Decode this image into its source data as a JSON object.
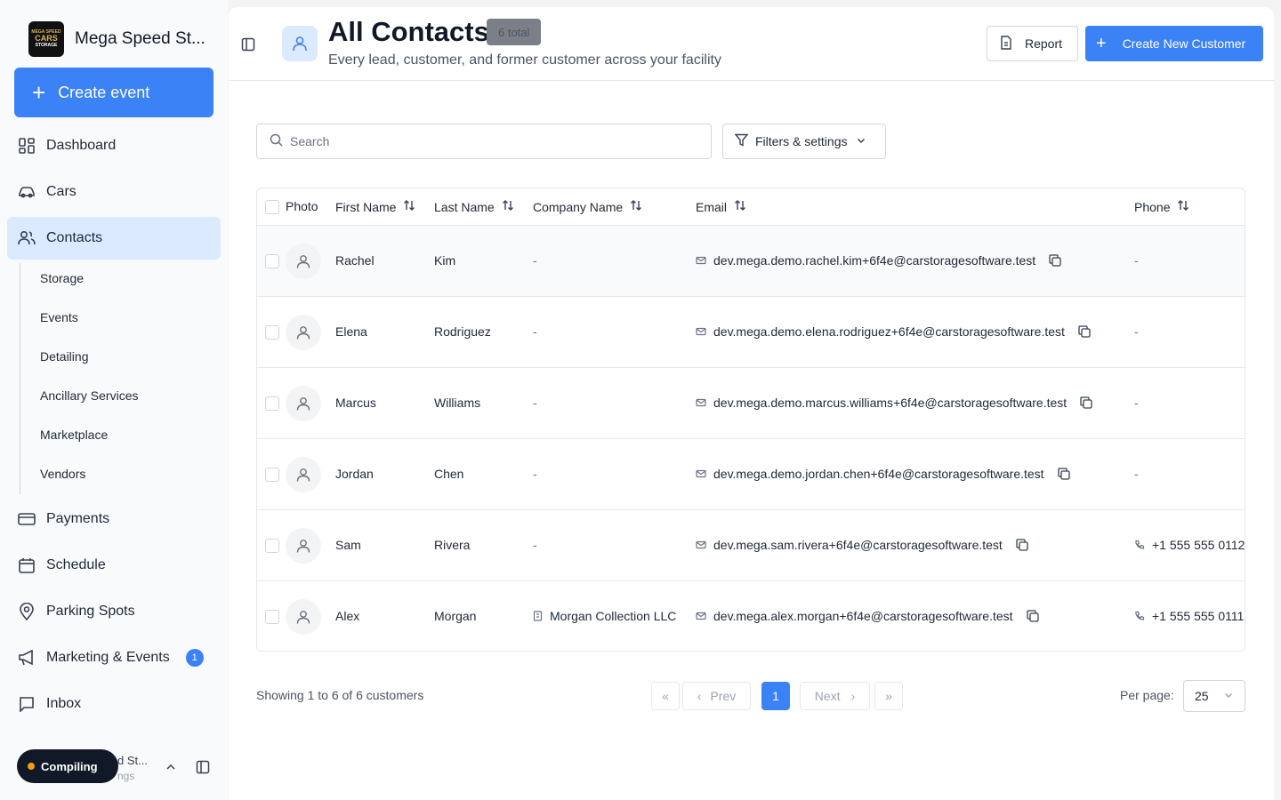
{
  "brand": {
    "name": "Mega Speed St...",
    "logo_text": [
      "MEGA SPEED",
      "CARS",
      "STORAGE"
    ]
  },
  "sidebar": {
    "create_label": "Create event",
    "nav": [
      {
        "label": "Dashboard",
        "icon": "dashboard-icon"
      },
      {
        "label": "Cars",
        "icon": "car-icon"
      },
      {
        "label": "Contacts",
        "icon": "users-icon",
        "active": true
      },
      {
        "label": "Payments",
        "icon": "credit-card-icon"
      },
      {
        "label": "Schedule",
        "icon": "calendar-icon"
      },
      {
        "label": "Parking Spots",
        "icon": "map-pin-icon"
      },
      {
        "label": "Marketing & Events",
        "icon": "megaphone-icon",
        "badge": "1"
      },
      {
        "label": "Inbox",
        "icon": "inbox-icon"
      }
    ],
    "subnav": [
      "Storage",
      "Events",
      "Detailing",
      "Ancillary Services",
      "Marketplace",
      "Vendors"
    ],
    "status_label": "Compiling",
    "user_name_peek": "d St...",
    "user_sub_peek": "ngs"
  },
  "header": {
    "title": "All Contacts",
    "badge": "6 total",
    "subtitle": "Every lead, customer, and former customer across your facility",
    "report_label": "Report",
    "create_label": "Create New Customer"
  },
  "toolbar": {
    "search_placeholder": "Search",
    "filters_label": "Filters & settings"
  },
  "table": {
    "columns": [
      "Photo",
      "First Name",
      "Last Name",
      "Company Name",
      "Email",
      "Phone"
    ],
    "rows": [
      {
        "first": "Rachel",
        "last": "Kim",
        "company": "-",
        "email": "dev.mega.demo.rachel.kim+6f4e@carstoragesoftware.test",
        "phone": "-"
      },
      {
        "first": "Elena",
        "last": "Rodriguez",
        "company": "-",
        "email": "dev.mega.demo.elena.rodriguez+6f4e@carstoragesoftware.test",
        "phone": "-"
      },
      {
        "first": "Marcus",
        "last": "Williams",
        "company": "-",
        "email": "dev.mega.demo.marcus.williams+6f4e@carstoragesoftware.test",
        "phone": "-"
      },
      {
        "first": "Jordan",
        "last": "Chen",
        "company": "-",
        "email": "dev.mega.demo.jordan.chen+6f4e@carstoragesoftware.test",
        "phone": "-"
      },
      {
        "first": "Sam",
        "last": "Rivera",
        "company": "-",
        "email": "dev.mega.sam.rivera+6f4e@carstoragesoftware.test",
        "phone": "+1 555 555 0112"
      },
      {
        "first": "Alex",
        "last": "Morgan",
        "company": "Morgan Collection LLC",
        "email": "dev.mega.alex.morgan+6f4e@carstoragesoftware.test",
        "phone": "+1 555 555 0111"
      }
    ]
  },
  "pagination": {
    "showing": "Showing 1 to 6 of 6 customers",
    "first": "«",
    "prev": "Prev",
    "current": "1",
    "next": "Next",
    "last": "»",
    "per_page_label": "Per page:",
    "per_page_value": "25"
  },
  "colors": {
    "accent": "#3b82f6",
    "active_nav_bg": "#dbeafe"
  }
}
